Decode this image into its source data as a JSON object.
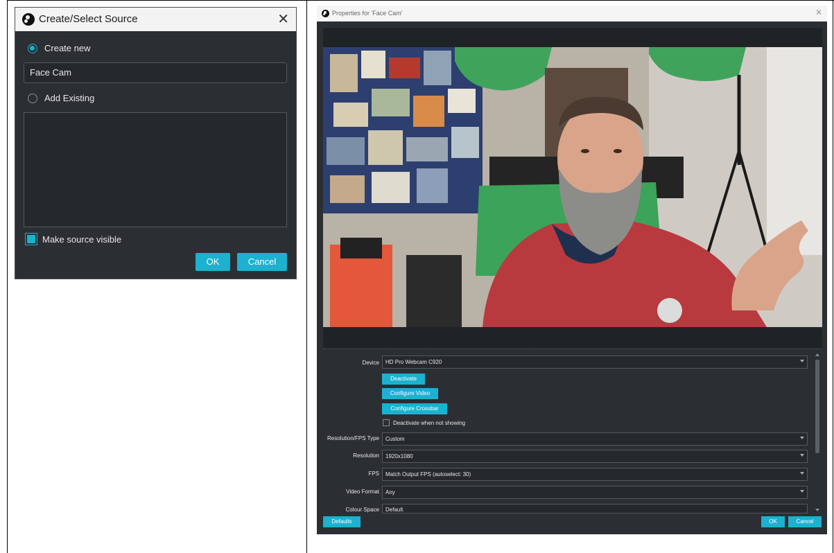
{
  "create_dialog": {
    "title": "Create/Select Source",
    "close_glyph": "✕",
    "create_new_label": "Create new",
    "source_name_value": "Face Cam",
    "add_existing_label": "Add Existing",
    "make_visible_label": "Make source visible",
    "make_visible_checked": true,
    "ok_label": "OK",
    "cancel_label": "Cancel"
  },
  "properties_dialog": {
    "title": "Properties for 'Face Cam'",
    "close_glyph": "✕",
    "device": {
      "label": "Device",
      "value": "HD Pro Webcam C920"
    },
    "deactivate_button": "Deactivate",
    "configure_video_button": "Configure Video",
    "configure_crossbar_button": "Configure Crossbar",
    "deactivate_when_not_showing": {
      "label": "Deactivate when not showing",
      "checked": false
    },
    "resolution_fps_type": {
      "label": "Resolution/FPS Type",
      "value": "Custom"
    },
    "resolution": {
      "label": "Resolution",
      "value": "1920x1080"
    },
    "fps": {
      "label": "FPS",
      "value": "Match Output FPS (autoselect: 30)"
    },
    "video_format": {
      "label": "Video Format",
      "value": "Any"
    },
    "colour_space": {
      "label": "Colour Space",
      "value": "Default"
    },
    "defaults_button": "Defaults",
    "ok_label": "OK",
    "cancel_label": "Cancel"
  },
  "colors": {
    "accent": "#1cb1cf",
    "dialog_bg": "#2b2e32",
    "field_bg": "#25282c"
  },
  "icons": {
    "obs_logo": "obs-logo-icon",
    "radio_selected": "radio-selected-icon",
    "radio_unselected": "radio-unselected-icon",
    "dropdown": "chevron-down-icon"
  }
}
